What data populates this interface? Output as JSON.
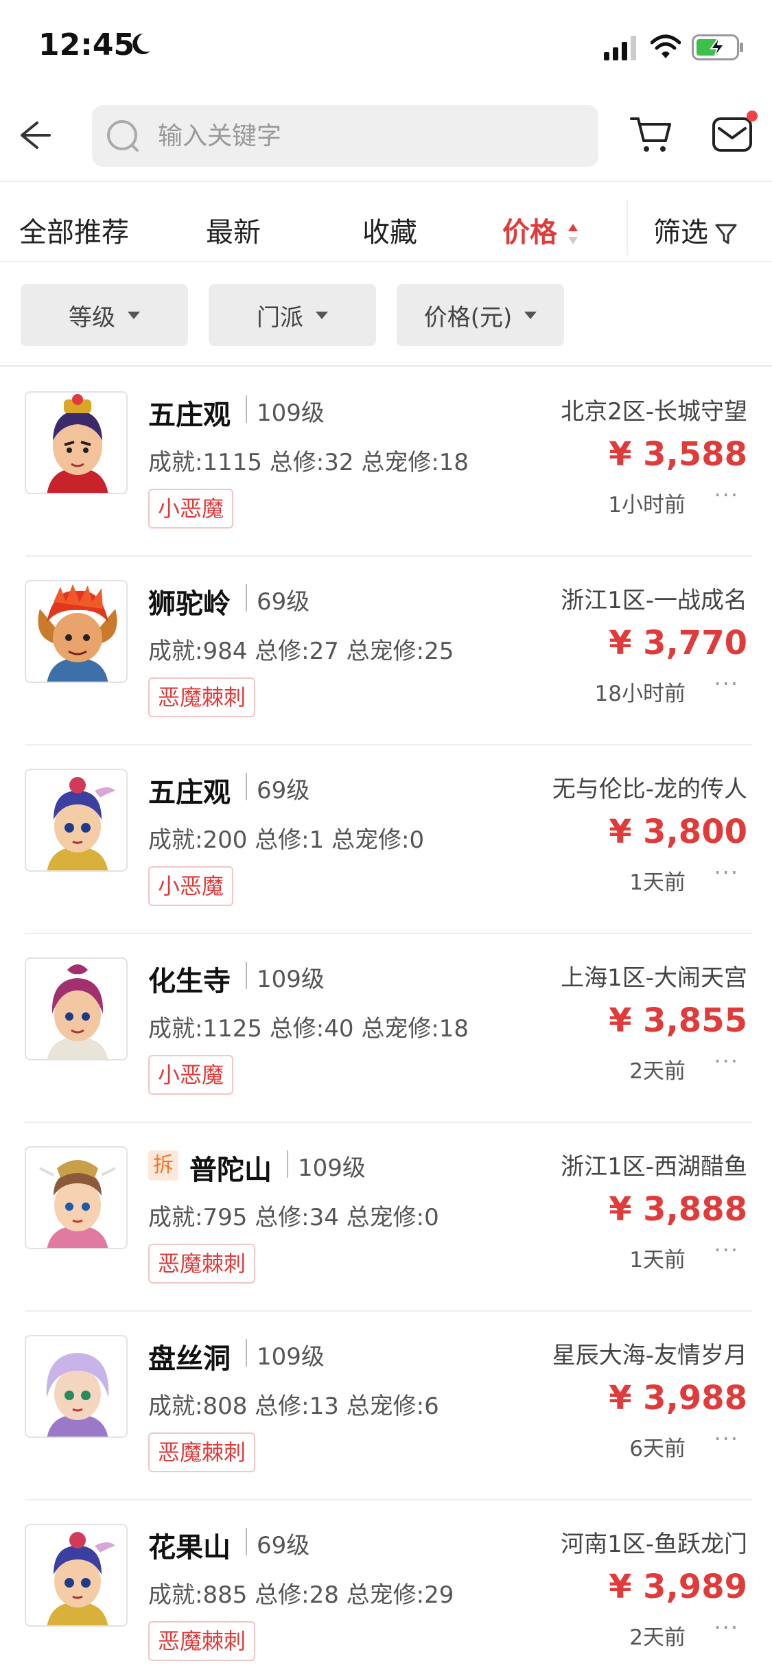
{
  "status_bar": {
    "time": "12:45"
  },
  "search": {
    "placeholder": "输入关键字",
    "value": ""
  },
  "sort_tabs": [
    "全部推荐",
    "最新",
    "收藏",
    "价格",
    "筛选"
  ],
  "filters": [
    "等级",
    "门派",
    "价格(元)"
  ],
  "colors": {
    "accent": "#e03b3b",
    "tag_border": "#f0c6c6",
    "chip_bg": "#ececec"
  },
  "listings": [
    {
      "school": "五庄观",
      "level": "109级",
      "stats": "成就:1115 总修:32 总宠修:18",
      "tag": "小恶魔",
      "server": "北京2区-长城守望",
      "price": "¥ 3,588",
      "time_ago": "1小时前",
      "badge": ""
    },
    {
      "school": "狮驼岭",
      "level": "69级",
      "stats": "成就:984 总修:27 总宠修:25",
      "tag": "恶魔棘刺",
      "server": "浙江1区-一战成名",
      "price": "¥ 3,770",
      "time_ago": "18小时前",
      "badge": ""
    },
    {
      "school": "五庄观",
      "level": "69级",
      "stats": "成就:200 总修:1 总宠修:0",
      "tag": "小恶魔",
      "server": "无与伦比-龙的传人",
      "price": "¥ 3,800",
      "time_ago": "1天前",
      "badge": ""
    },
    {
      "school": "化生寺",
      "level": "109级",
      "stats": "成就:1125 总修:40 总宠修:18",
      "tag": "小恶魔",
      "server": "上海1区-大闹天宫",
      "price": "¥ 3,855",
      "time_ago": "2天前",
      "badge": ""
    },
    {
      "school": "普陀山",
      "level": "109级",
      "stats": "成就:795 总修:34 总宠修:0",
      "tag": "恶魔棘刺",
      "server": "浙江1区-西湖醋鱼",
      "price": "¥ 3,888",
      "time_ago": "1天前",
      "badge": "拆"
    },
    {
      "school": "盘丝洞",
      "level": "109级",
      "stats": "成就:808 总修:13 总宠修:6",
      "tag": "恶魔棘刺",
      "server": "星辰大海-友情岁月",
      "price": "¥ 3,988",
      "time_ago": "6天前",
      "badge": ""
    },
    {
      "school": "花果山",
      "level": "69级",
      "stats": "成就:885 总修:28 总宠修:29",
      "tag": "恶魔棘刺",
      "server": "河南1区-鱼跃龙门",
      "price": "¥ 3,989",
      "time_ago": "2天前",
      "badge": ""
    }
  ]
}
